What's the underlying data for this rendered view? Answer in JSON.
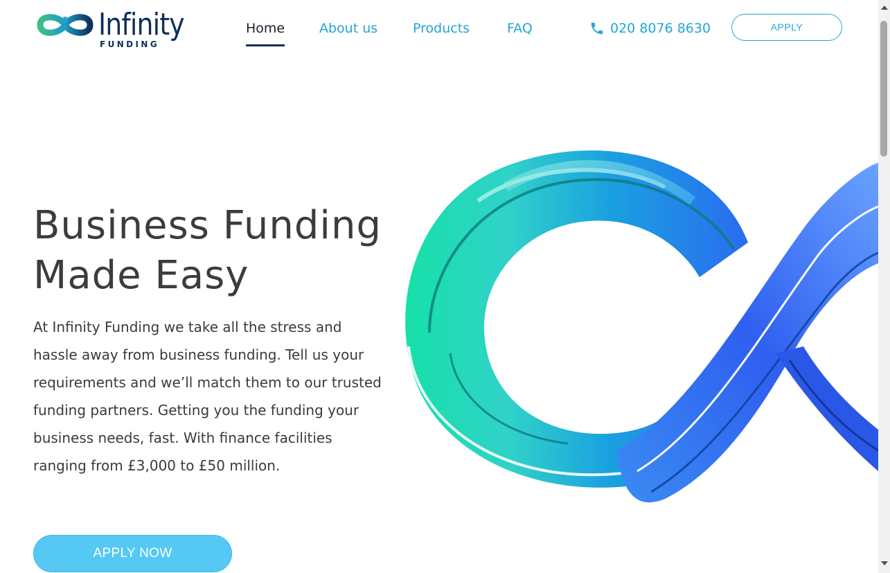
{
  "brand": {
    "name": "Infinity",
    "tagline": "FUNDING",
    "colors": {
      "navy": "#0e2f59",
      "accent": "#22a5d6",
      "button": "#55c8f4"
    }
  },
  "nav": {
    "items": [
      {
        "label": "Home",
        "active": true
      },
      {
        "label": "About us",
        "active": false
      },
      {
        "label": "Products",
        "active": false
      },
      {
        "label": "FAQ",
        "active": false
      }
    ]
  },
  "contact": {
    "phone": "020 8076 8630",
    "icon": "phone-icon"
  },
  "header": {
    "apply_label": "APPLY"
  },
  "hero": {
    "title_line1": "Business Funding",
    "title_line2": "Made Easy",
    "text": "At Infinity Funding we take all the stress and hassle away from business funding. Tell us your requirements and we’ll match them to our trusted funding partners. Getting you the funding your business needs, fast. With finance facilities ranging from £3,000 to £50 million.",
    "cta_label": "APPLY NOW",
    "image": "infinity-ribbon-graphic"
  }
}
